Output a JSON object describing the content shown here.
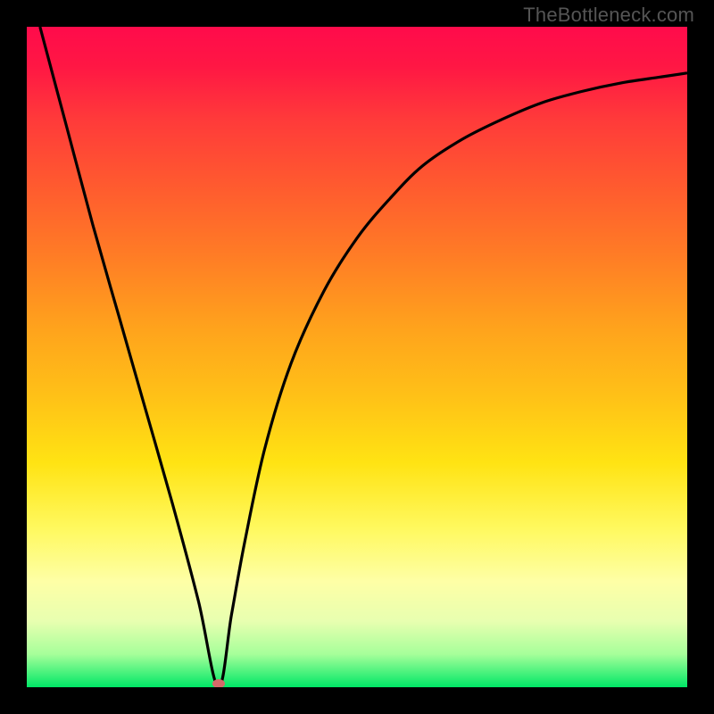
{
  "watermark": "TheBottleneck.com",
  "colors": {
    "curve": "#000000",
    "dot": "#d46a6a",
    "frame": "#000000"
  },
  "chart_data": {
    "type": "line",
    "title": "",
    "xlabel": "",
    "ylabel": "",
    "xlim": [
      0,
      100
    ],
    "ylim": [
      0,
      100
    ],
    "grid": false,
    "legend": false,
    "notes": "V-shaped bottleneck curve; minimum (optimal match) marked with oval dot near x≈29.",
    "minimum_point": {
      "x": 29,
      "y": 0
    },
    "series": [
      {
        "name": "bottleneck-curve",
        "x": [
          2,
          6,
          10,
          14,
          18,
          22,
          26,
          29,
          31,
          33,
          36,
          40,
          45,
          50,
          55,
          60,
          66,
          72,
          78,
          84,
          90,
          96,
          100
        ],
        "values": [
          100,
          85,
          70,
          56,
          42,
          28,
          13,
          0,
          11,
          22,
          36,
          49,
          60,
          68,
          74,
          79,
          83,
          86,
          88.5,
          90.2,
          91.5,
          92.4,
          93
        ]
      }
    ]
  }
}
